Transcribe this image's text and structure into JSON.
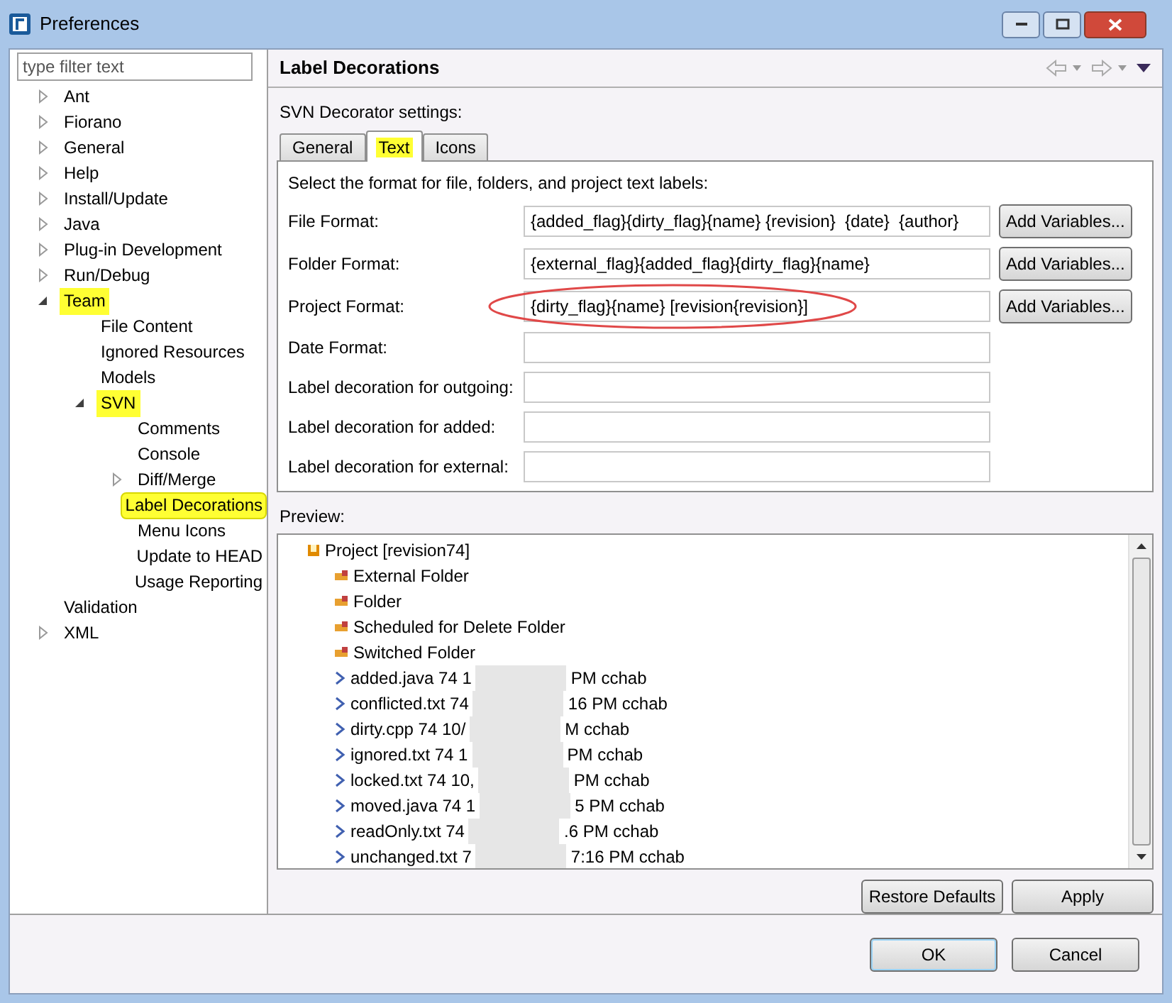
{
  "window": {
    "title": "Preferences"
  },
  "filter": {
    "placeholder": "type filter text"
  },
  "tree": [
    {
      "label": "Ant",
      "expandable": true,
      "expanded": false,
      "highlighted": false,
      "selected": false
    },
    {
      "label": "Fiorano",
      "expandable": true,
      "expanded": false,
      "highlighted": false,
      "selected": false
    },
    {
      "label": "General",
      "expandable": true,
      "expanded": false,
      "highlighted": false,
      "selected": false
    },
    {
      "label": "Help",
      "expandable": true,
      "expanded": false,
      "highlighted": false,
      "selected": false
    },
    {
      "label": "Install/Update",
      "expandable": true,
      "expanded": false,
      "highlighted": false,
      "selected": false
    },
    {
      "label": "Java",
      "expandable": true,
      "expanded": false,
      "highlighted": false,
      "selected": false
    },
    {
      "label": "Plug-in Development",
      "expandable": true,
      "expanded": false,
      "highlighted": false,
      "selected": false
    },
    {
      "label": "Run/Debug",
      "expandable": true,
      "expanded": false,
      "highlighted": false,
      "selected": false
    },
    {
      "label": "Team",
      "expandable": true,
      "expanded": true,
      "highlighted": true,
      "selected": false,
      "children": [
        {
          "label": "File Content",
          "expandable": false,
          "expanded": false,
          "highlighted": false,
          "selected": false
        },
        {
          "label": "Ignored Resources",
          "expandable": false,
          "expanded": false,
          "highlighted": false,
          "selected": false
        },
        {
          "label": "Models",
          "expandable": false,
          "expanded": false,
          "highlighted": false,
          "selected": false
        },
        {
          "label": "SVN",
          "expandable": true,
          "expanded": true,
          "highlighted": true,
          "selected": false,
          "children": [
            {
              "label": "Comments",
              "expandable": false,
              "expanded": false,
              "highlighted": false,
              "selected": false
            },
            {
              "label": "Console",
              "expandable": false,
              "expanded": false,
              "highlighted": false,
              "selected": false
            },
            {
              "label": "Diff/Merge",
              "expandable": true,
              "expanded": false,
              "highlighted": false,
              "selected": false
            },
            {
              "label": "Label Decorations",
              "expandable": false,
              "expanded": false,
              "highlighted": true,
              "selected": true
            },
            {
              "label": "Menu Icons",
              "expandable": false,
              "expanded": false,
              "highlighted": false,
              "selected": false
            },
            {
              "label": "Update to HEAD",
              "expandable": false,
              "expanded": false,
              "highlighted": false,
              "selected": false
            },
            {
              "label": "Usage Reporting",
              "expandable": false,
              "expanded": false,
              "highlighted": false,
              "selected": false
            }
          ]
        }
      ]
    },
    {
      "label": "Validation",
      "expandable": false,
      "expanded": false,
      "highlighted": false,
      "selected": false
    },
    {
      "label": "XML",
      "expandable": true,
      "expanded": false,
      "highlighted": false,
      "selected": false
    }
  ],
  "page": {
    "title": "Label Decorations",
    "section": "SVN Decorator settings:"
  },
  "tabs": [
    {
      "label": "General",
      "selected": false,
      "highlighted": false
    },
    {
      "label": "Text",
      "selected": true,
      "highlighted": true
    },
    {
      "label": "Icons",
      "selected": false,
      "highlighted": false
    }
  ],
  "intro": "Select the format for file, folders, and project text labels:",
  "fields": [
    {
      "label": "File Format:",
      "value": "{added_flag}{dirty_flag}{name} {revision}  {date}  {author}",
      "button": "Add Variables...",
      "circled": false
    },
    {
      "label": "Folder Format:",
      "value": "{external_flag}{added_flag}{dirty_flag}{name}",
      "button": "Add Variables...",
      "circled": false
    },
    {
      "label": "Project Format:",
      "value": "{dirty_flag}{name} [revision{revision}]",
      "button": "Add Variables...",
      "circled": true
    },
    {
      "label": "Date Format:",
      "circled": false
    },
    {
      "label": "Label decoration for outgoing:",
      "circled": false
    },
    {
      "label": "Label decoration for added:",
      "circled": false
    },
    {
      "label": "Label decoration for external:",
      "circled": false
    }
  ],
  "preview": {
    "label": "Preview:",
    "items": [
      {
        "kind": "project",
        "text": "Project [revision74]"
      },
      {
        "kind": "folder",
        "text": "External Folder"
      },
      {
        "kind": "folder",
        "text": "Folder"
      },
      {
        "kind": "folder",
        "text": "Scheduled for Delete Folder"
      },
      {
        "kind": "folder",
        "text": "Switched Folder"
      },
      {
        "kind": "file",
        "text": "added.java 74  1",
        "text_after": "PM  cchab"
      },
      {
        "kind": "file",
        "text": "conflicted.txt 74",
        "text_after": "16 PM  cchab"
      },
      {
        "kind": "file",
        "text": "dirty.cpp 74  10/",
        "text_after": "M  cchab"
      },
      {
        "kind": "file",
        "text": "ignored.txt 74  1",
        "text_after": "PM  cchab"
      },
      {
        "kind": "file",
        "text": "locked.txt 74  10,",
        "text_after": "PM  cchab"
      },
      {
        "kind": "file",
        "text": "moved.java 74  1",
        "text_after": "5 PM  cchab"
      },
      {
        "kind": "file",
        "text": "readOnly.txt 74",
        "text_after": ".6 PM  cchab"
      },
      {
        "kind": "file",
        "text": "unchanged.txt 7",
        "text_after": "7:16 PM  cchab"
      }
    ]
  },
  "page_buttons": [
    "Restore Defaults",
    "Apply"
  ],
  "dialog_buttons": [
    {
      "label": "OK",
      "default": true
    },
    {
      "label": "Cancel",
      "default": false
    }
  ]
}
